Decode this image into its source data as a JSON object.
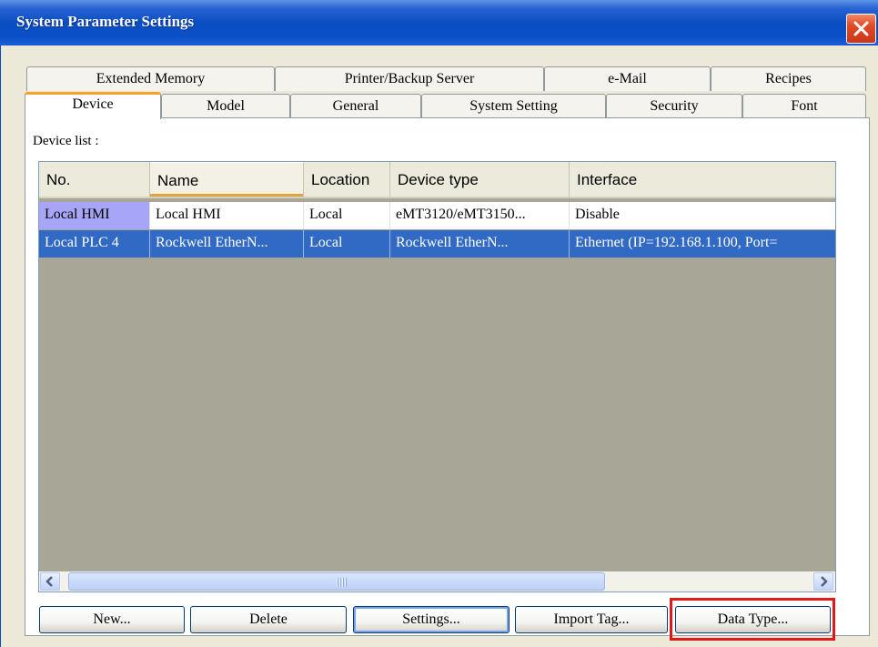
{
  "window": {
    "title": "System Parameter Settings"
  },
  "tabs_row1": [
    {
      "label": "Extended Memory"
    },
    {
      "label": "Printer/Backup Server"
    },
    {
      "label": "e-Mail"
    },
    {
      "label": "Recipes"
    }
  ],
  "tabs_row2": [
    {
      "label": "Device",
      "active": true
    },
    {
      "label": "Model"
    },
    {
      "label": "General"
    },
    {
      "label": "System Setting"
    },
    {
      "label": "Security"
    },
    {
      "label": "Font"
    }
  ],
  "device_list": {
    "label": "Device list :",
    "columns": [
      "No.",
      "Name",
      "Location",
      "Device type",
      "Interface"
    ],
    "rows": [
      [
        "Local HMI",
        "Local HMI",
        "Local",
        "eMT3120/eMT3150...",
        "Disable"
      ],
      [
        "Local PLC 4",
        "Rockwell EtherN...",
        "Local",
        "Rockwell EtherN...",
        "Ethernet (IP=192.168.1.100, Port="
      ]
    ],
    "selected_row": 1
  },
  "buttons": {
    "new": "New...",
    "delete": "Delete",
    "settings": "Settings...",
    "import_tag": "Import Tag...",
    "data_type": "Data Type..."
  },
  "colors": {
    "title_bar": "#0A4EC2",
    "selection": "#316AC5",
    "highlight_box": "#E01A1A",
    "active_tab_accent": "#F3A32A"
  }
}
